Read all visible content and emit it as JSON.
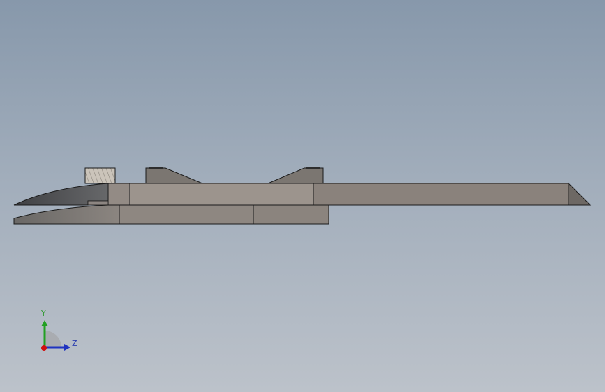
{
  "triad": {
    "y_label": "Y",
    "z_label": "Z",
    "colors": {
      "y_axis": "#22a022",
      "z_axis": "#1f33c0",
      "x_axis": "#d01010"
    }
  },
  "colors": {
    "background_top": "#8798ab",
    "background_bottom": "#bcc2ca",
    "body_light": "#9a918a",
    "body_mid": "#8c857f",
    "body_dark": "#6e6a66",
    "jaw_dark": "#555658",
    "outline": "#1a1a1a",
    "thumb_wheel": "#c9c2b8"
  }
}
